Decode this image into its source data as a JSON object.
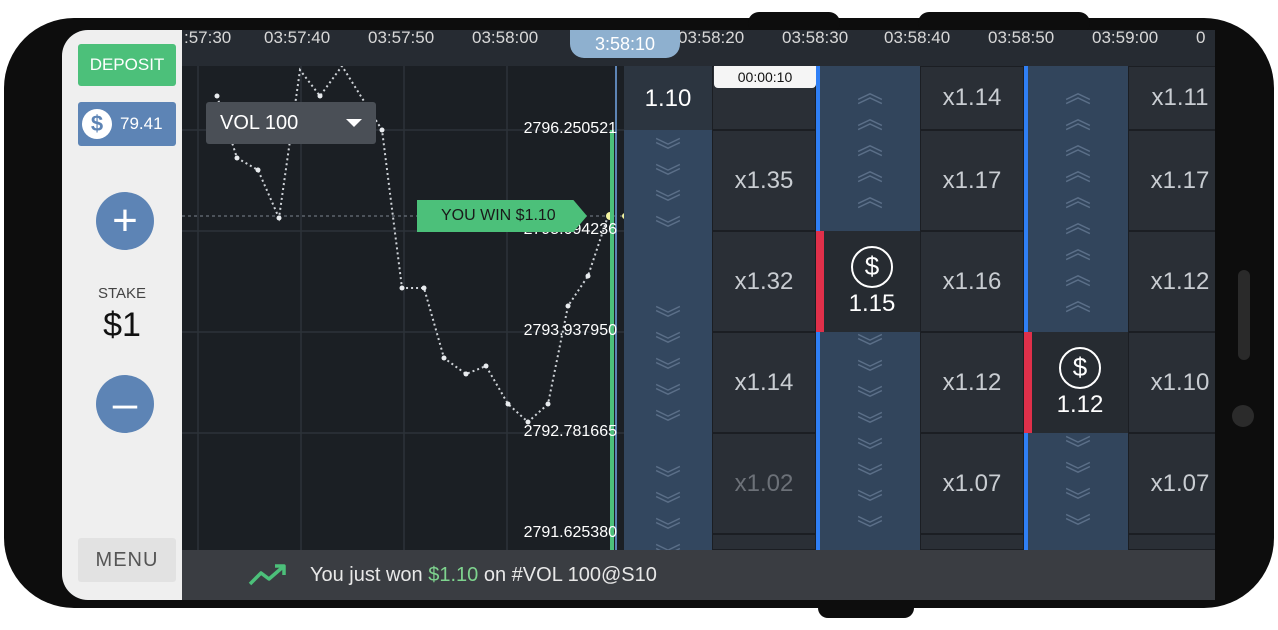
{
  "sidebar": {
    "deposit_label": "DEPOSIT",
    "balance": "79.41",
    "balance_icon": "$",
    "add_label": "+",
    "stake_label": "STAKE",
    "stake_value": "$1",
    "subtract_label": "–",
    "menu_label": "MENU"
  },
  "chart": {
    "time_ticks": [
      ":57:30",
      "03:57:40",
      "03:57:50",
      "03:58:00",
      "03:58:20",
      "03:58:30",
      "03:58:40",
      "03:58:50",
      "03:59:00",
      "0"
    ],
    "current_time": "3:58:10",
    "instrument": "VOL 100",
    "prices": [
      "2796.250521",
      "2795.094236",
      "2793.937950",
      "2792.781665",
      "2791.625380"
    ],
    "win_label": "YOU WIN $1.10",
    "timer": "00:00:10"
  },
  "grid": {
    "col1": [
      "x1.35",
      "x1.32",
      "x1.14",
      "x1.02"
    ],
    "col3": [
      "x1.14",
      "x1.17",
      "x1.16",
      "x1.12",
      "x1.07"
    ],
    "col5": [
      "x1.11",
      "x1.17",
      "x1.12",
      "x1.10",
      "x1.07"
    ],
    "bets": [
      {
        "icon": "$",
        "amount": "1.10"
      },
      {
        "icon": "$",
        "amount": "1.15"
      },
      {
        "icon": "$",
        "amount": "1.12"
      }
    ]
  },
  "footer": {
    "prefix": "You just won",
    "amount": "$1.10",
    "suffix": "on #VOL 100@S10"
  },
  "colors": {
    "green": "#4cc07a",
    "blue": "#5d84b5",
    "loss_red": "#e0304a",
    "up_blue": "#2f7ff5"
  }
}
